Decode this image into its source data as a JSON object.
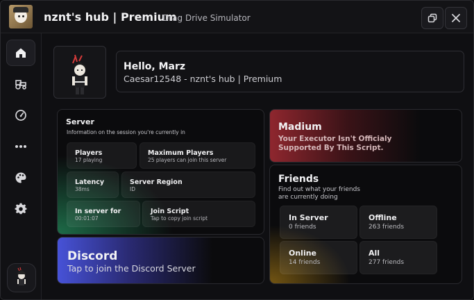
{
  "window": {
    "title": "nznt's hub | Premium",
    "subtitle": "Drag Drive Simulator",
    "icons": {
      "minimize": "minimize-window-icon",
      "close": "close-icon"
    }
  },
  "sidebar": {
    "items": [
      {
        "name": "home",
        "icon": "home-icon",
        "active": true
      },
      {
        "name": "vehicle",
        "icon": "tractor-icon",
        "active": false
      },
      {
        "name": "speed",
        "icon": "speedometer-icon",
        "active": false
      },
      {
        "name": "misc",
        "icon": "more-dots-icon",
        "active": false
      },
      {
        "name": "theme",
        "icon": "palette-icon",
        "active": false
      },
      {
        "name": "settings",
        "icon": "gear-icon",
        "active": false
      }
    ]
  },
  "profile": {
    "greeting": "Hello, Marz",
    "subline": "Caesar12548 - nznt's hub | Premium"
  },
  "server": {
    "title": "Server",
    "description": "Information on the session you're currently in",
    "tiles": [
      {
        "title": "Players",
        "sub": "17 playing"
      },
      {
        "title": "Maximum Players",
        "sub": "25 players can join this server"
      },
      {
        "title": "Latency",
        "sub": "38ms"
      },
      {
        "title": "Server Region",
        "sub": "ID"
      },
      {
        "title": "In server for",
        "sub": "00:01:07"
      },
      {
        "title": "Join Script",
        "sub": "Tap to copy join script"
      }
    ]
  },
  "discord": {
    "title": "Discord",
    "sub": "Tap to join the Discord Server"
  },
  "executor": {
    "title": "Madium",
    "line1": "Your Executor Isn't Officialy",
    "line2": "Supported By This Script."
  },
  "friends": {
    "title": "Friends",
    "line1": "Find out what your friends",
    "line2": "are currently doing",
    "tiles": [
      {
        "title": "In Server",
        "sub": "0 friends"
      },
      {
        "title": "Offline",
        "sub": "263 friends"
      },
      {
        "title": "Online",
        "sub": "14 friends"
      },
      {
        "title": "All",
        "sub": "277 friends"
      }
    ]
  },
  "colors": {
    "server_accent": "#248c5c",
    "discord_accent": "#4a56e2",
    "executor_accent": "#962830",
    "friends_accent": "#966e14"
  }
}
